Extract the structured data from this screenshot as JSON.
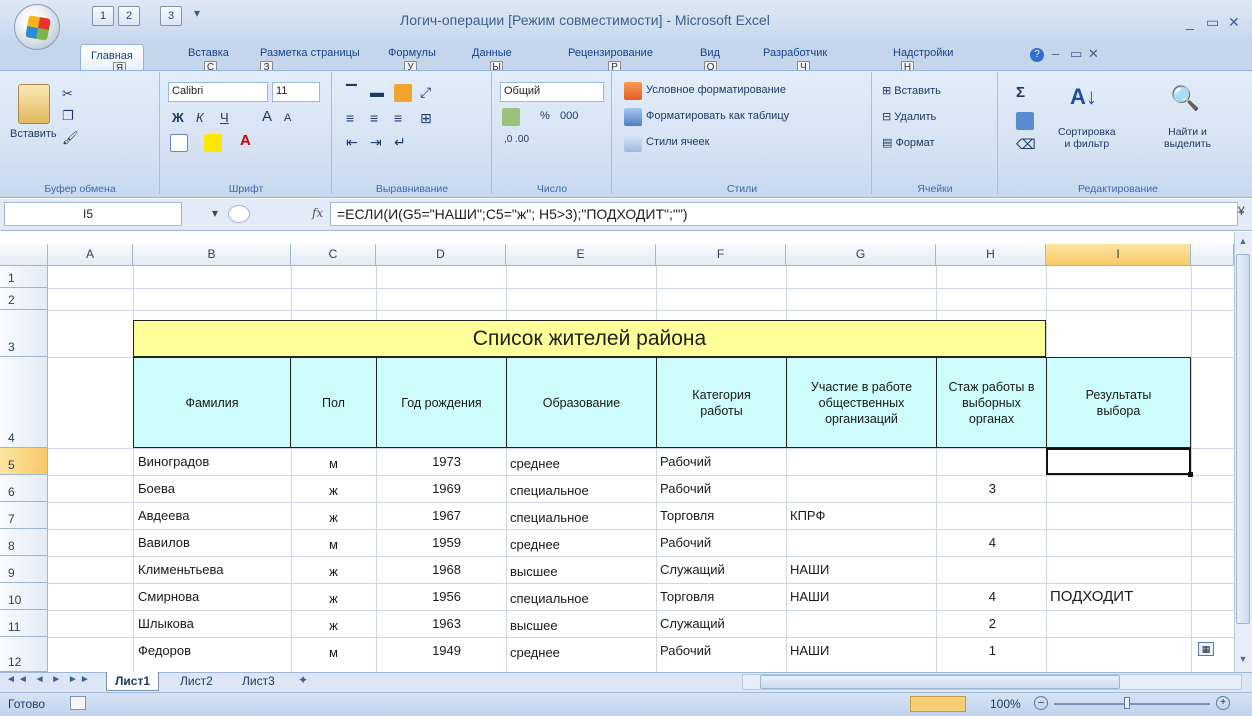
{
  "window": {
    "title": "Логич-операции  [Режим совместимости] - Microsoft Excel",
    "qat": [
      "1",
      "2",
      "3"
    ]
  },
  "tabs": [
    {
      "label": "Главная",
      "key": "Я"
    },
    {
      "label": "Вставка",
      "key": "С"
    },
    {
      "label": "Разметка страницы",
      "key": "З"
    },
    {
      "label": "Формулы",
      "key": "У"
    },
    {
      "label": "Данные",
      "key": "Ы"
    },
    {
      "label": "Рецензирование",
      "key": "Р"
    },
    {
      "label": "Вид",
      "key": "О"
    },
    {
      "label": "Разработчик",
      "key": "Ч"
    },
    {
      "label": "Надстройки",
      "key": "Н"
    }
  ],
  "ribbon": {
    "clipboard": {
      "paste": "Вставить",
      "label": "Буфер обмена"
    },
    "font": {
      "name": "Calibri",
      "size": "11",
      "label": "Шрифт",
      "bold": "Ж",
      "italic": "К",
      "underline": "Ч",
      "grow": "A",
      "shrink": "A"
    },
    "alignment": {
      "label": "Выравнивание"
    },
    "number": {
      "format": "Общий",
      "percent": "%",
      "thousands": "000",
      "label": "Число"
    },
    "styles": {
      "conditional": "Условное форматирование",
      "as_table": "Форматировать как таблицу",
      "cell_styles": "Стили ячеек",
      "label": "Стили"
    },
    "cells": {
      "insert": "Вставить",
      "delete": "Удалить",
      "format": "Формат",
      "label": "Ячейки"
    },
    "editing": {
      "sort": "Сортировка\nи фильтр",
      "find": "Найти и\nвыделить",
      "label": "Редактирование",
      "sigma": "Σ"
    }
  },
  "formula_bar": {
    "name_box": "I5",
    "fx": "fx",
    "formula": "=ЕСЛИ(И(G5=\"НАШИ\";C5=\"ж\"; H5>3);\"ПОДХОДИТ\";\"\")"
  },
  "columns": [
    "A",
    "B",
    "C",
    "D",
    "E",
    "F",
    "G",
    "H",
    "I"
  ],
  "rows": [
    "1",
    "2",
    "3",
    "4",
    "5",
    "6",
    "7",
    "8",
    "9",
    "10",
    "11",
    "12"
  ],
  "table": {
    "title": "Список жителей района",
    "headers": [
      "Фамилия",
      "Пол",
      "Год рождения",
      "Образование",
      "Категория работы",
      "Участие в работе общественных организаций",
      "Стаж работы в выборных органах",
      "Результаты выбора"
    ],
    "rows": [
      [
        "Виноградов",
        "м",
        "1973",
        "среднее",
        "Рабочий",
        "",
        "",
        ""
      ],
      [
        "Боева",
        "ж",
        "1969",
        "специальное",
        "Рабочий",
        "",
        "3",
        ""
      ],
      [
        "Авдеева",
        "ж",
        "1967",
        "специальное",
        "Торговля",
        "КПРФ",
        "",
        ""
      ],
      [
        "Вавилов",
        "м",
        "1959",
        "среднее",
        "Рабочий",
        "",
        "4",
        ""
      ],
      [
        "Клименьтьева",
        "ж",
        "1968",
        "высшее",
        "Служащий",
        "НАШИ",
        "",
        ""
      ],
      [
        "Смирнова",
        "ж",
        "1956",
        "специальное",
        "Торговля",
        "НАШИ",
        "4",
        "ПОДХОДИТ"
      ],
      [
        "Шлыкова",
        "ж",
        "1963",
        "высшее",
        "Служащий",
        "",
        "2",
        ""
      ],
      [
        "Федоров",
        "м",
        "1949",
        "среднее",
        "Рабочий",
        "НАШИ",
        "1",
        ""
      ]
    ]
  },
  "sheets": [
    "Лист1",
    "Лист2",
    "Лист3"
  ],
  "status": {
    "ready": "Готово",
    "zoom": "100%"
  }
}
